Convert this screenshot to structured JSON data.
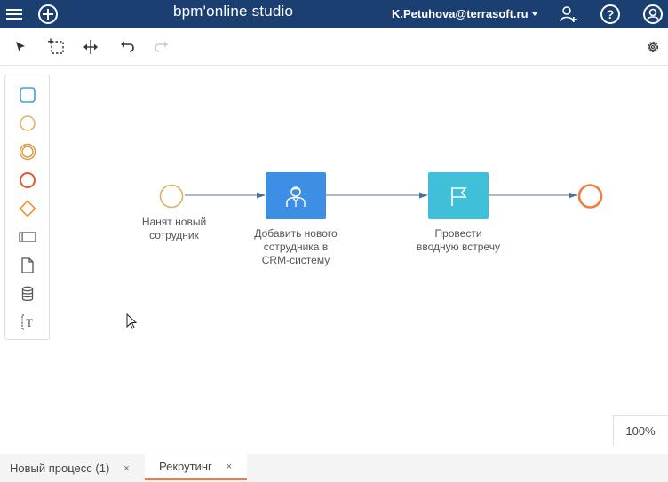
{
  "header": {
    "brand": "bpm'online studio",
    "user": "K.Petuhova@terrasoft.ru",
    "icons": [
      "menu-icon",
      "add-icon",
      "user-add-icon",
      "help-icon",
      "profile-icon"
    ]
  },
  "toolbar": {
    "tools": [
      "select-pointer-icon",
      "lasso-select-icon",
      "space-tool-icon",
      "undo-icon",
      "redo-icon"
    ],
    "settings_icon": "gear-icon"
  },
  "palette": {
    "items": [
      "user-task-icon",
      "start-event-icon",
      "intermediate-event-icon",
      "end-event-icon",
      "gateway-icon",
      "lane-icon",
      "document-icon",
      "datastore-icon",
      "annotation-icon"
    ]
  },
  "diagram": {
    "start_label": [
      "Нанят новый",
      "сотрудник"
    ],
    "task1_label": [
      "Добавить нового",
      "сотрудника в",
      "CRM-систему"
    ],
    "task2_label": [
      "Провести",
      "вводную встречу"
    ],
    "colors": {
      "start": "#e0b05a",
      "task1": "#3d8fe6",
      "task2": "#3fbfd8",
      "end": "#f07d3a",
      "flow": "#8aa0bf"
    }
  },
  "zoom": "100%",
  "tabs": [
    {
      "label": "Новый процесс (1)",
      "close": "×",
      "active": false
    },
    {
      "label": "Рекрутинг",
      "close": "×",
      "active": true
    }
  ]
}
